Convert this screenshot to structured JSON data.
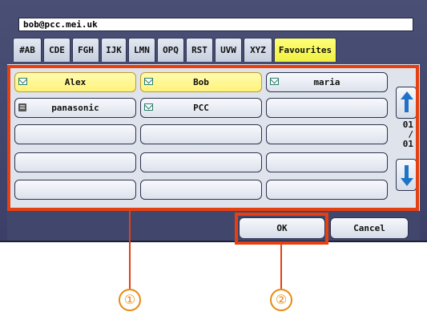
{
  "address_bar": {
    "value": "bob@pcc.mei.uk"
  },
  "tabs": [
    {
      "label": "#AB"
    },
    {
      "label": "CDE"
    },
    {
      "label": "FGH"
    },
    {
      "label": "IJK"
    },
    {
      "label": "LMN"
    },
    {
      "label": "OPQ"
    },
    {
      "label": "RST"
    },
    {
      "label": "UVW"
    },
    {
      "label": "XYZ"
    },
    {
      "label": "Favourites"
    }
  ],
  "active_tab": "Favourites",
  "entries": [
    {
      "label": "Alex",
      "icon": "envelope-icon",
      "selected": true
    },
    {
      "label": "Bob",
      "icon": "envelope-icon",
      "selected": true
    },
    {
      "label": "maria",
      "icon": "envelope-icon",
      "selected": false
    },
    {
      "label": "panasonic",
      "icon": "fax-icon",
      "selected": false
    },
    {
      "label": "PCC",
      "icon": "envelope-icon",
      "selected": false
    },
    {
      "label": "",
      "icon": "",
      "selected": false
    },
    {
      "label": "",
      "icon": "",
      "selected": false
    },
    {
      "label": "",
      "icon": "",
      "selected": false
    },
    {
      "label": "",
      "icon": "",
      "selected": false
    },
    {
      "label": "",
      "icon": "",
      "selected": false
    },
    {
      "label": "",
      "icon": "",
      "selected": false
    },
    {
      "label": "",
      "icon": "",
      "selected": false
    },
    {
      "label": "",
      "icon": "",
      "selected": false
    },
    {
      "label": "",
      "icon": "",
      "selected": false
    },
    {
      "label": "",
      "icon": "",
      "selected": false
    }
  ],
  "pagination": {
    "current": "01",
    "separator": "/",
    "total": "01"
  },
  "scroll": {
    "up_icon": "arrow-up-icon",
    "down_icon": "arrow-down-icon"
  },
  "buttons": {
    "ok_label": "OK",
    "cancel_label": "Cancel"
  },
  "callouts": {
    "one": "①",
    "two": "②"
  },
  "colors": {
    "panel": "#4a4f75",
    "tab_active": "#ffff7a",
    "selected_entry": "#fff37a",
    "highlight": "#e64010",
    "callout": "#e88a10",
    "arrow": "#1e73c8"
  }
}
